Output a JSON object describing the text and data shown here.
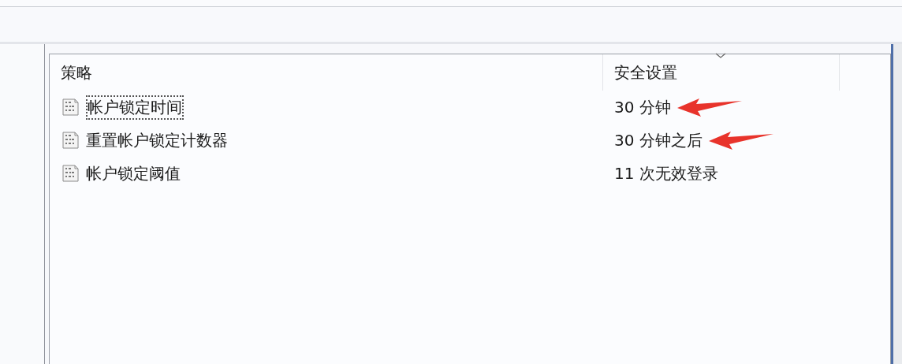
{
  "list": {
    "columns": [
      {
        "label": "策略",
        "sort_caret": false
      },
      {
        "label": "安全设置",
        "sort_caret": true
      }
    ],
    "rows": [
      {
        "policy": "帐户锁定时间",
        "setting": "30 分钟",
        "focused": true,
        "arrow": true
      },
      {
        "policy": "重置帐户锁定计数器",
        "setting": "30 分钟之后",
        "focused": false,
        "arrow": true
      },
      {
        "policy": "帐户锁定阈值",
        "setting": "11 次无效登录",
        "focused": false,
        "arrow": false
      }
    ]
  }
}
